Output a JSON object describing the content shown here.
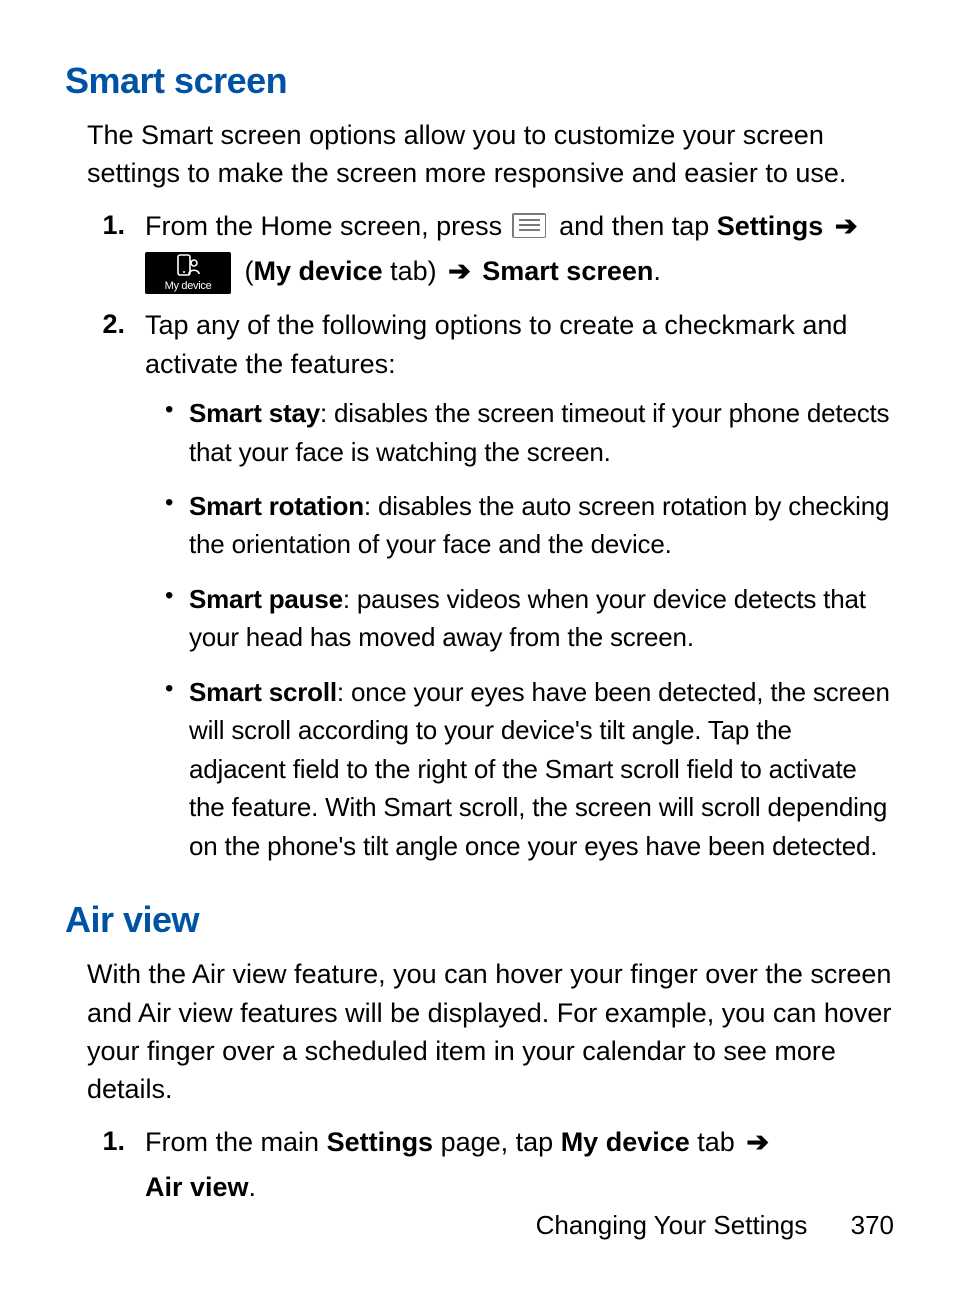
{
  "sections": {
    "smartScreen": {
      "heading": "Smart screen",
      "intro": "The Smart screen options allow you to customize your screen settings to make the screen more responsive and easier to use.",
      "step1": {
        "num": "1.",
        "pre": "From the Home screen, press ",
        "mid": " and then tap ",
        "settings": "Settings",
        "arrow1": "➔",
        "myDeviceLabel": "My device",
        "open": " (",
        "my": "My device",
        "tab": " tab) ",
        "arrow2": "➔",
        "smart": " Smart screen",
        "dot": "."
      },
      "step2": {
        "num": "2.",
        "text": "Tap any of the following options to create a checkmark and activate the features:"
      },
      "bullets": [
        {
          "term": "Smart stay",
          "desc": ": disables the screen timeout if your phone detects that your face is watching the screen."
        },
        {
          "term": "Smart rotation",
          "desc": ": disables the auto screen rotation by checking the orientation of your face and the device."
        },
        {
          "term": "Smart pause",
          "desc": ": pauses videos when your device detects that your head has moved away from the screen."
        },
        {
          "term": "Smart scroll",
          "desc": ": once your eyes have been detected, the screen will scroll according to your device's tilt angle. Tap the adjacent field to the right of the Smart scroll field to activate the feature. With Smart scroll, the screen will scroll depending on the phone's tilt angle once your eyes have been detected."
        }
      ]
    },
    "airView": {
      "heading": "Air view",
      "intro": "With the Air view feature, you can hover your finger over the screen and Air view features will be displayed. For example, you can hover your finger over a scheduled item in your calendar to see more details.",
      "step1": {
        "num": "1.",
        "pre": "From the main ",
        "settings": "Settings",
        "mid": " page, tap ",
        "my": "My device",
        "tab": " tab ",
        "arrow": "➔",
        "air": "Air view",
        "dot": "."
      }
    }
  },
  "footer": {
    "chapter": "Changing Your Settings",
    "page": "370"
  },
  "icons": {
    "menu": "menu-icon",
    "myDeviceText": "My device"
  }
}
